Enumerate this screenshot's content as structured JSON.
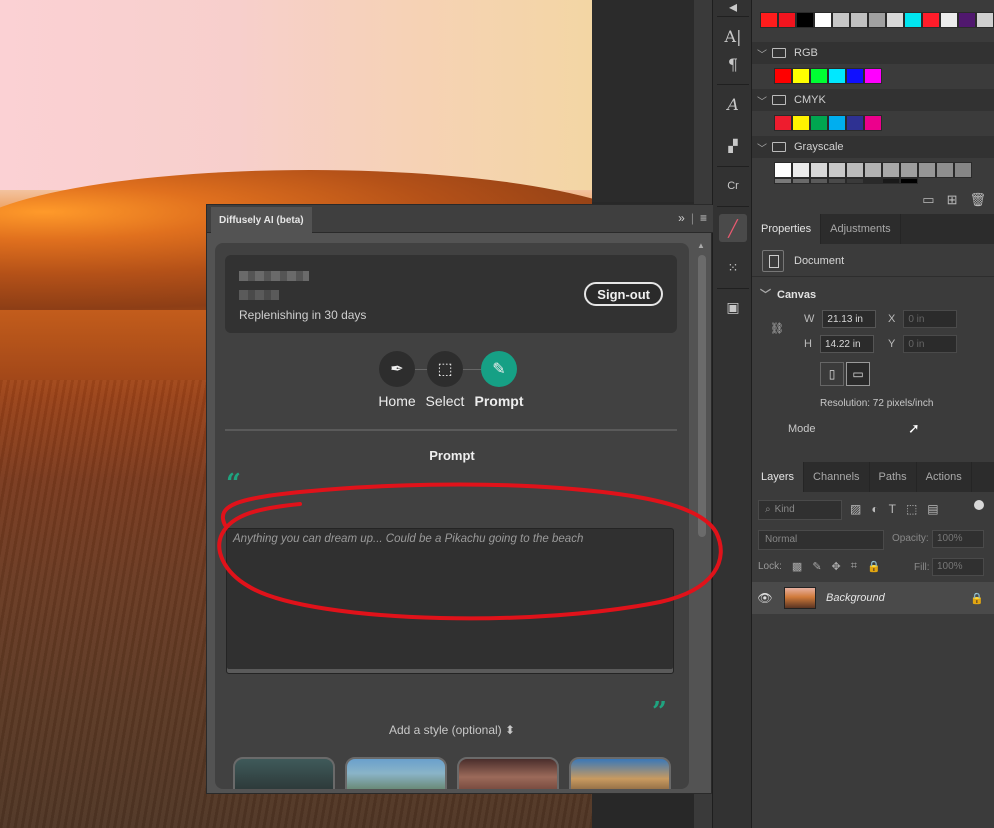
{
  "plugin": {
    "title": "Diffusely AI (beta)",
    "expand_icon": "double-chevron-right-icon",
    "menu_icon": "hamburger-menu-icon",
    "account": {
      "replenish_text": "Replenishing in 30 days",
      "signout_label": "Sign-out"
    },
    "steps": [
      {
        "label": "Home",
        "icon": "brush-icon",
        "active": false
      },
      {
        "label": "Select",
        "icon": "selection-cursor-icon",
        "active": false
      },
      {
        "label": "Prompt",
        "icon": "pen-icon",
        "active": true
      }
    ],
    "prompt_title": "Prompt",
    "prompt_placeholder": "Anything you can dream up... Could be a Pikachu going to the beach",
    "prompt_value": "",
    "style_link": "Add a style (optional) ⬍",
    "accent_color": "#16a085"
  },
  "swatches": {
    "groups": [
      {
        "name": "RGB"
      },
      {
        "name": "CMYK"
      },
      {
        "name": "Grayscale"
      }
    ]
  },
  "properties": {
    "tabs": [
      "Properties",
      "Adjustments"
    ],
    "document_label": "Document",
    "canvas_label": "Canvas",
    "w_label": "W",
    "w_value": "21.13 in",
    "h_label": "H",
    "h_value": "14.22 in",
    "x_label": "X",
    "x_value": "0 in",
    "y_label": "Y",
    "y_value": "0 in",
    "resolution": "Resolution: 72 pixels/inch",
    "mode_label": "Mode"
  },
  "layers": {
    "tabs": [
      "Layers",
      "Channels",
      "Paths",
      "Actions"
    ],
    "filter_placeholder": "Kind",
    "blend_mode": "Normal",
    "opacity_label": "Opacity:",
    "opacity_value": "100%",
    "lock_label": "Lock:",
    "fill_label": "Fill:",
    "fill_value": "100%",
    "items": [
      {
        "name": "Background",
        "visible": true,
        "locked": true
      }
    ]
  },
  "annotation_color": "#e0121a"
}
